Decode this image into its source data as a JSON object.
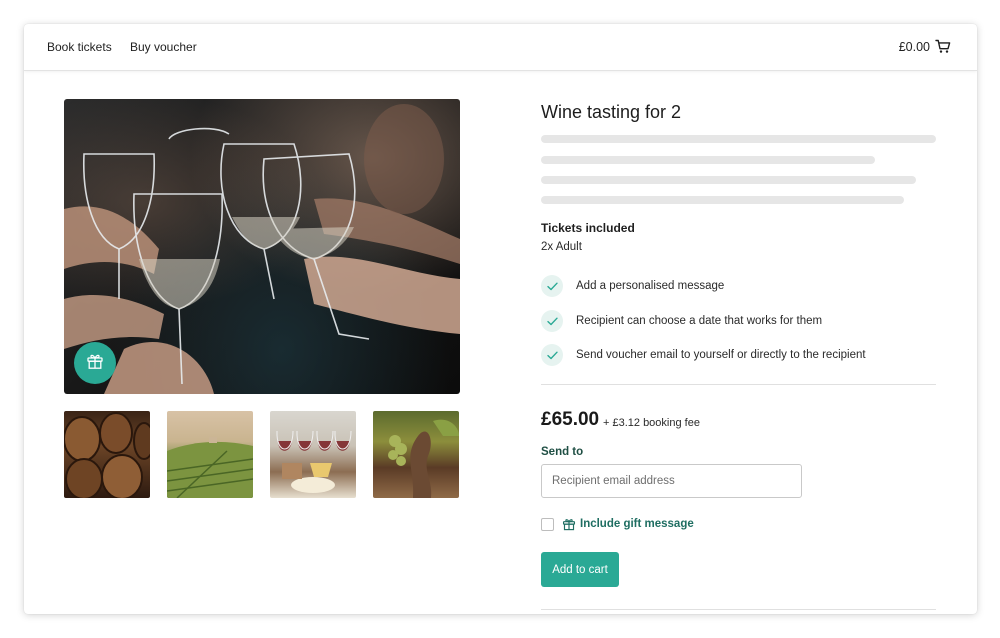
{
  "nav": {
    "book_tickets": "Book tickets",
    "buy_voucher": "Buy voucher",
    "cart_total": "£0.00"
  },
  "product": {
    "title": "Wine tasting for 2",
    "tickets_heading": "Tickets included",
    "tickets_value": "2x Adult",
    "features": [
      "Add a personalised message",
      "Recipient can choose a date that works for them",
      "Send voucher email to yourself or directly to the recipient"
    ],
    "price": "£65.00",
    "booking_fee": "+ £3.12 booking fee",
    "send_to_label": "Send to",
    "email_placeholder": "Recipient email address",
    "gift_message_label": "Include gift message",
    "add_to_cart": "Add to cart"
  },
  "colors": {
    "accent": "#2aa995",
    "accent_dark_text": "#1f6e62",
    "check_bg": "#e6f3f0",
    "skeleton": "#e6e6e6"
  },
  "icons": {
    "cart": "cart-icon",
    "gift": "gift-icon",
    "check": "check-icon"
  }
}
